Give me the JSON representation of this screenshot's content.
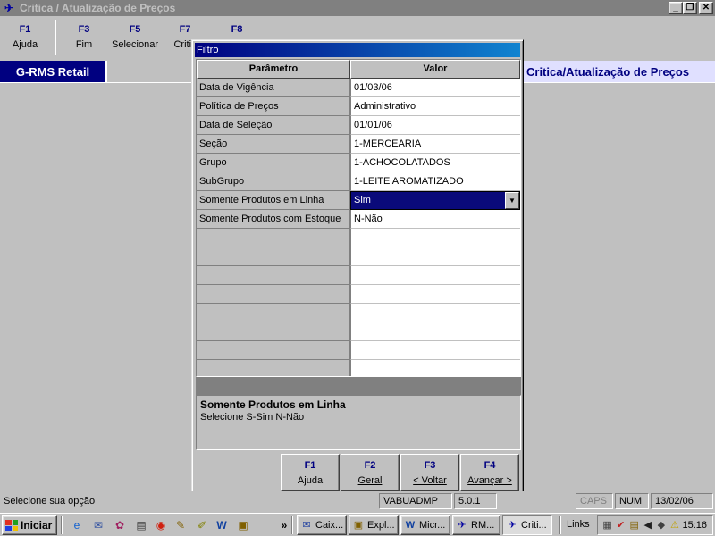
{
  "window": {
    "title": "Critica / Atualização de Preços",
    "icon": "app-icon",
    "controls": [
      "_",
      "❐",
      "✕"
    ]
  },
  "fkeys": [
    {
      "key": "F1",
      "label": "Ajuda"
    },
    {
      "key": "F3",
      "label": "Fim"
    },
    {
      "key": "F5",
      "label": "Selecionar"
    },
    {
      "key": "F7",
      "label": "Critic"
    },
    {
      "key": "F8",
      "label": ""
    }
  ],
  "header": {
    "brand": "G-RMS Retail",
    "screen_title": "Critica/Atualização de Preços"
  },
  "dialog": {
    "title": "Filtro",
    "columns": {
      "param": "Parâmetro",
      "value": "Valor"
    },
    "rows": [
      {
        "param": "Data de Vigência",
        "value": "01/03/06"
      },
      {
        "param": "Política de Preços",
        "value": "Administrativo"
      },
      {
        "param": "Data de Seleção",
        "value": "01/01/06"
      },
      {
        "param": "Seção",
        "value": "1-MERCEARIA"
      },
      {
        "param": "Grupo",
        "value": "1-ACHOCOLATADOS"
      },
      {
        "param": "SubGrupo",
        "value": "1-LEITE AROMATIZADO"
      },
      {
        "param": "Somente Produtos em Linha",
        "value": "Sim"
      },
      {
        "param": "Somente Produtos com Estoque",
        "value": "N-Não"
      }
    ],
    "help": {
      "title": "Somente Produtos em Linha",
      "text": "Selecione S-Sim N-Não"
    },
    "buttons": [
      {
        "key": "F1",
        "label": "Ajuda"
      },
      {
        "key": "F2",
        "label": "Geral"
      },
      {
        "key": "F3",
        "label": "< Voltar"
      },
      {
        "key": "F4",
        "label": "Avançar >"
      }
    ]
  },
  "status": {
    "message": "Selecione sua opção",
    "user": "VABUADMP",
    "version": "5.0.1",
    "caps": "CAPS",
    "num": "NUM",
    "date": "13/02/06"
  },
  "taskbar": {
    "start": "Iniciar",
    "quicklaunch": [
      "ie-icon",
      "outlook-icon",
      "paint-icon",
      "terminal-icon",
      "media-icon",
      "notepad-icon",
      "edit-icon",
      "word-icon",
      "explorer-icon"
    ],
    "overflow": "»",
    "tasks": [
      {
        "label": "Caix...",
        "icon": "mail-icon"
      },
      {
        "label": "Expl...",
        "icon": "folder-icon"
      },
      {
        "label": "Micr...",
        "icon": "word-icon"
      },
      {
        "label": "RM...",
        "icon": "app-icon"
      },
      {
        "label": "Criti...",
        "icon": "app-icon"
      }
    ],
    "links": "Links",
    "clock": "15:16"
  }
}
